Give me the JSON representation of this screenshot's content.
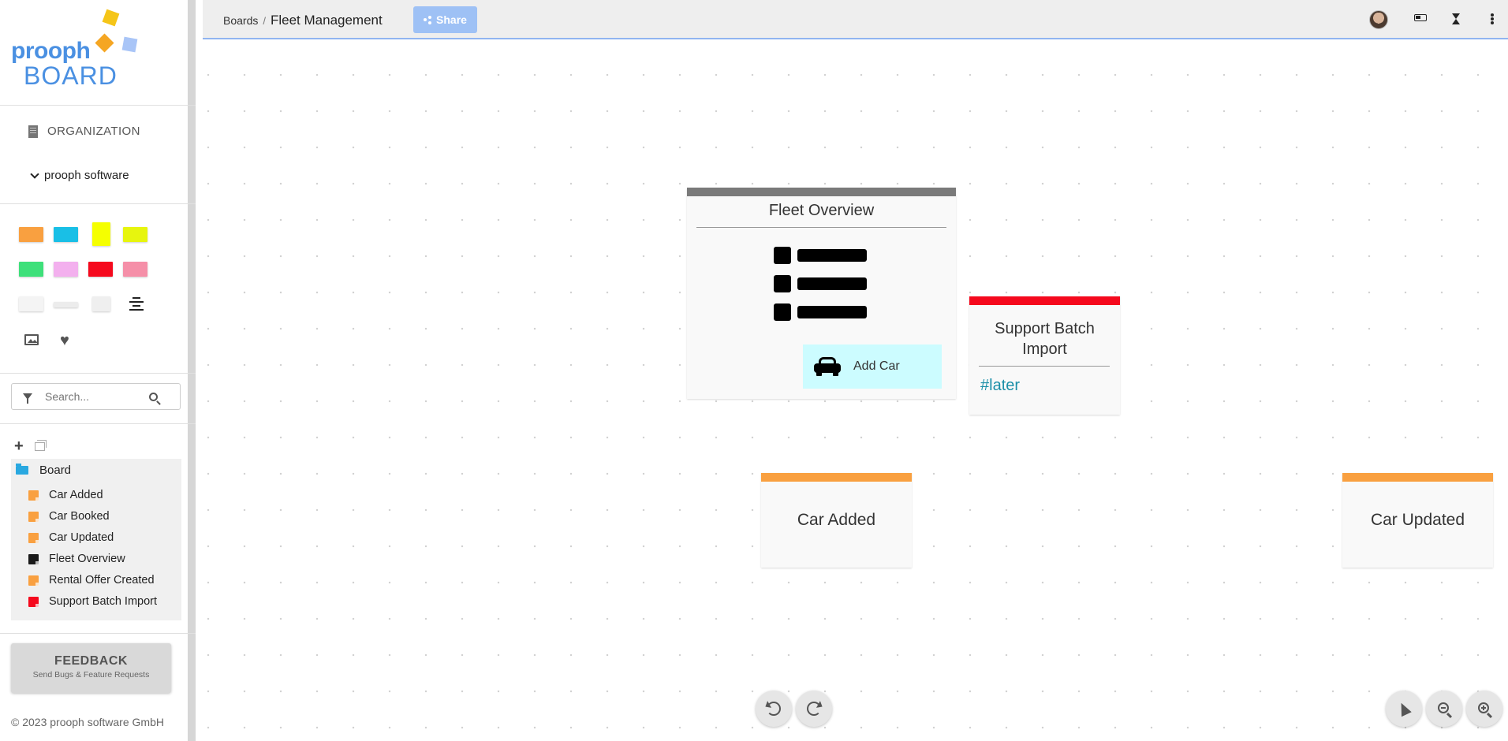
{
  "logo": {
    "word1": "prooph",
    "word2": "BOARD",
    "colors": [
      "#f5c518",
      "#f5a623",
      "#a9c5f7"
    ]
  },
  "sidebar": {
    "organization_label": "ORGANIZATION",
    "team_label": "prooph software",
    "palette": {
      "items": [
        {
          "name": "event",
          "color": "#f9a040"
        },
        {
          "name": "command",
          "color": "#19bfe6"
        },
        {
          "name": "aggregate",
          "color": "#f5ff00"
        },
        {
          "name": "document",
          "color": "#e7f50e"
        },
        {
          "name": "policy",
          "color": "#3ee07a"
        },
        {
          "name": "role",
          "color": "#f3b0ee"
        },
        {
          "name": "hot-spot",
          "color": "#f5091d"
        },
        {
          "name": "external-system",
          "color": "#f58fa8"
        },
        {
          "name": "ui",
          "color": "#f4f4f4"
        },
        {
          "name": "feature",
          "color": "#ececec"
        },
        {
          "name": "bounded-context",
          "color": "#efefef"
        },
        {
          "name": "text",
          "icon": "align-center-icon"
        },
        {
          "name": "image",
          "icon": "image-icon"
        },
        {
          "name": "favorites",
          "icon": "heart-icon"
        }
      ]
    },
    "search": {
      "placeholder": "Search..."
    },
    "tree": {
      "root_label": "Board",
      "items": [
        {
          "label": "Car Added",
          "color": "#f9a040"
        },
        {
          "label": "Car Booked",
          "color": "#f9a040"
        },
        {
          "label": "Car Updated",
          "color": "#f9a040"
        },
        {
          "label": "Fleet Overview",
          "color": "#1a1a1a"
        },
        {
          "label": "Rental Offer Created",
          "color": "#f9a040"
        },
        {
          "label": "Support Batch Import",
          "color": "#f5091d"
        }
      ]
    },
    "feedback": {
      "title": "FEEDBACK",
      "subtitle": "Send Bugs & Feature Requests"
    },
    "copyright": "© 2023 prooph software GmbH"
  },
  "topbar": {
    "breadcrumb_root": "Boards",
    "breadcrumb_sep": "/",
    "board_title": "Fleet Management",
    "share_label": "Share"
  },
  "canvas": {
    "cards": {
      "fleet_overview": {
        "title": "Fleet Overview",
        "bar_color": "#7a7a7a",
        "button_label": "Add Car"
      },
      "support_batch": {
        "title": "Support Batch Import",
        "tag": "#later",
        "bar_color": "#f5091d"
      },
      "car_added": {
        "title": "Car Added",
        "bar_color": "#f9a040"
      },
      "car_updated": {
        "title": "Car Updated",
        "bar_color": "#f9a040"
      }
    }
  }
}
